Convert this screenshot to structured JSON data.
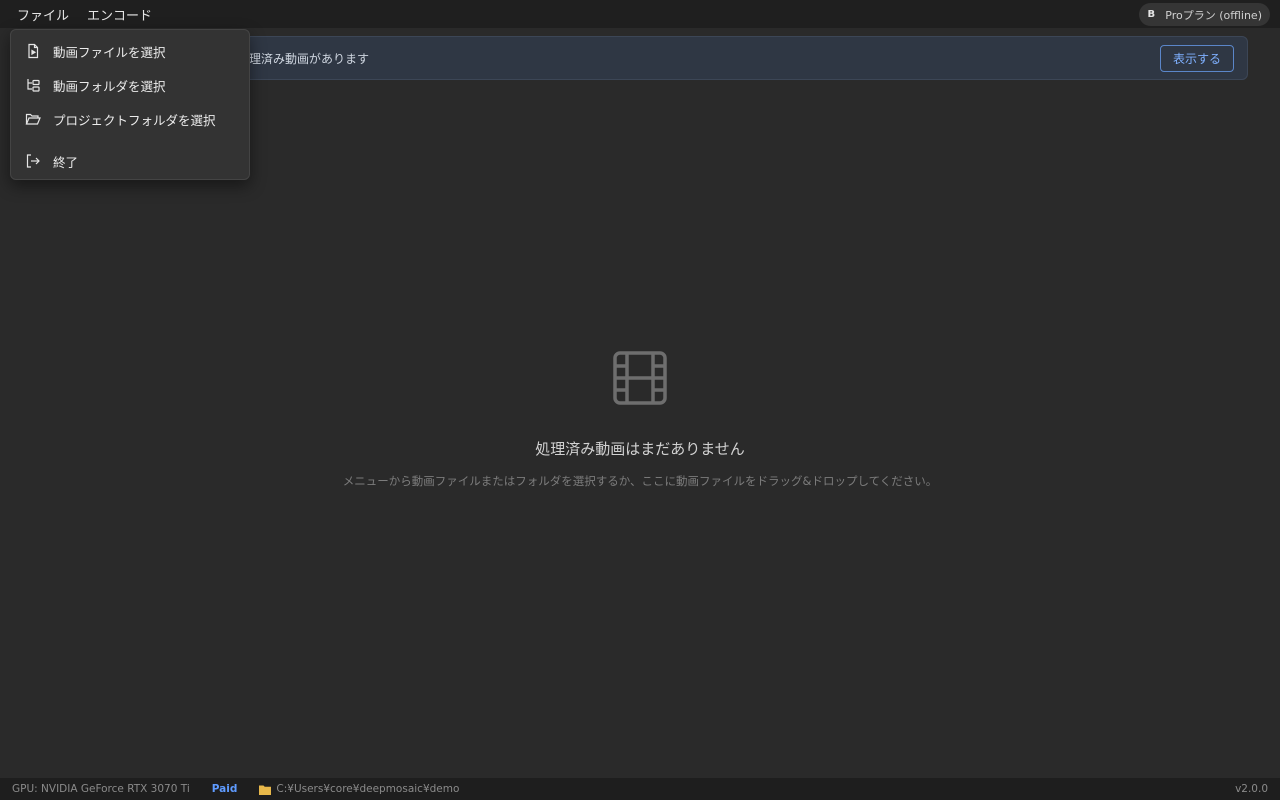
{
  "menubar": {
    "file_label": "ファイル",
    "encode_label": "エンコード"
  },
  "plan": {
    "avatar_letter": "B",
    "label": "Proプラン (offline)"
  },
  "banner": {
    "text": "理済み動画があります",
    "button_label": "表示する"
  },
  "file_menu": {
    "items": [
      {
        "label": "動画ファイルを選択",
        "icon": "video-file-icon"
      },
      {
        "label": "動画フォルダを選択",
        "icon": "folder-tree-icon"
      },
      {
        "label": "プロジェクトフォルダを選択",
        "icon": "folder-open-icon"
      },
      {
        "label": "終了",
        "icon": "exit-icon"
      }
    ]
  },
  "empty_state": {
    "icon": "film-icon",
    "title": "処理済み動画はまだありません",
    "subtitle": "メニューから動画ファイルまたはフォルダを選択するか、ここに動画ファイルをドラッグ&ドロップしてください。"
  },
  "statusbar": {
    "gpu": "GPU: NVIDIA GeForce RTX 3070 Ti",
    "license": "Paid",
    "path": "C:¥Users¥core¥deepmosaic¥demo",
    "version": "v2.0.0"
  },
  "colors": {
    "background": "#2a2a2a",
    "menubar": "#1f1f1f",
    "accent": "#5f9bff",
    "folder": "#e8b84a"
  }
}
